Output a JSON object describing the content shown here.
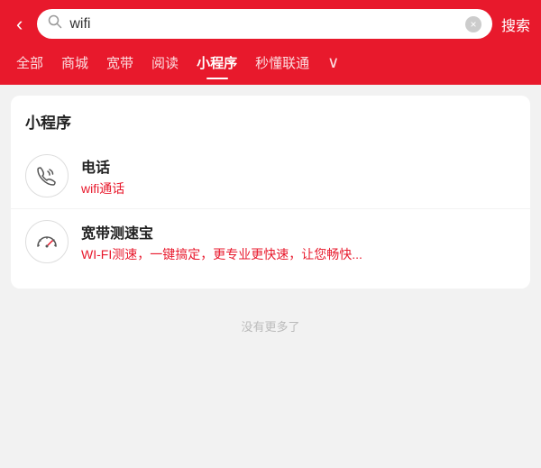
{
  "header": {
    "back_label": "‹",
    "search_value": "wifi",
    "clear_icon": "×",
    "search_btn_label": "搜索"
  },
  "nav": {
    "tabs": [
      {
        "id": "all",
        "label": "全部",
        "active": false
      },
      {
        "id": "mall",
        "label": "商城",
        "active": false
      },
      {
        "id": "broadband",
        "label": "宽带",
        "active": false
      },
      {
        "id": "reading",
        "label": "阅读",
        "active": false
      },
      {
        "id": "miniapp",
        "label": "小程序",
        "active": true
      },
      {
        "id": "smart",
        "label": "秒懂联通",
        "active": false
      }
    ],
    "more_icon": "∨"
  },
  "section": {
    "title": "小程序",
    "items": [
      {
        "id": "phone-wifi",
        "title": "电话",
        "subtitle": "wifi通话",
        "icon_type": "phone-wifi"
      },
      {
        "id": "speedtest",
        "title": "宽带测速宝",
        "subtitle": "WI-FI测速，一键搞定，更专业更快速，让您畅快...",
        "icon_type": "speedometer"
      }
    ]
  },
  "footer": {
    "no_more_label": "没有更多了"
  }
}
